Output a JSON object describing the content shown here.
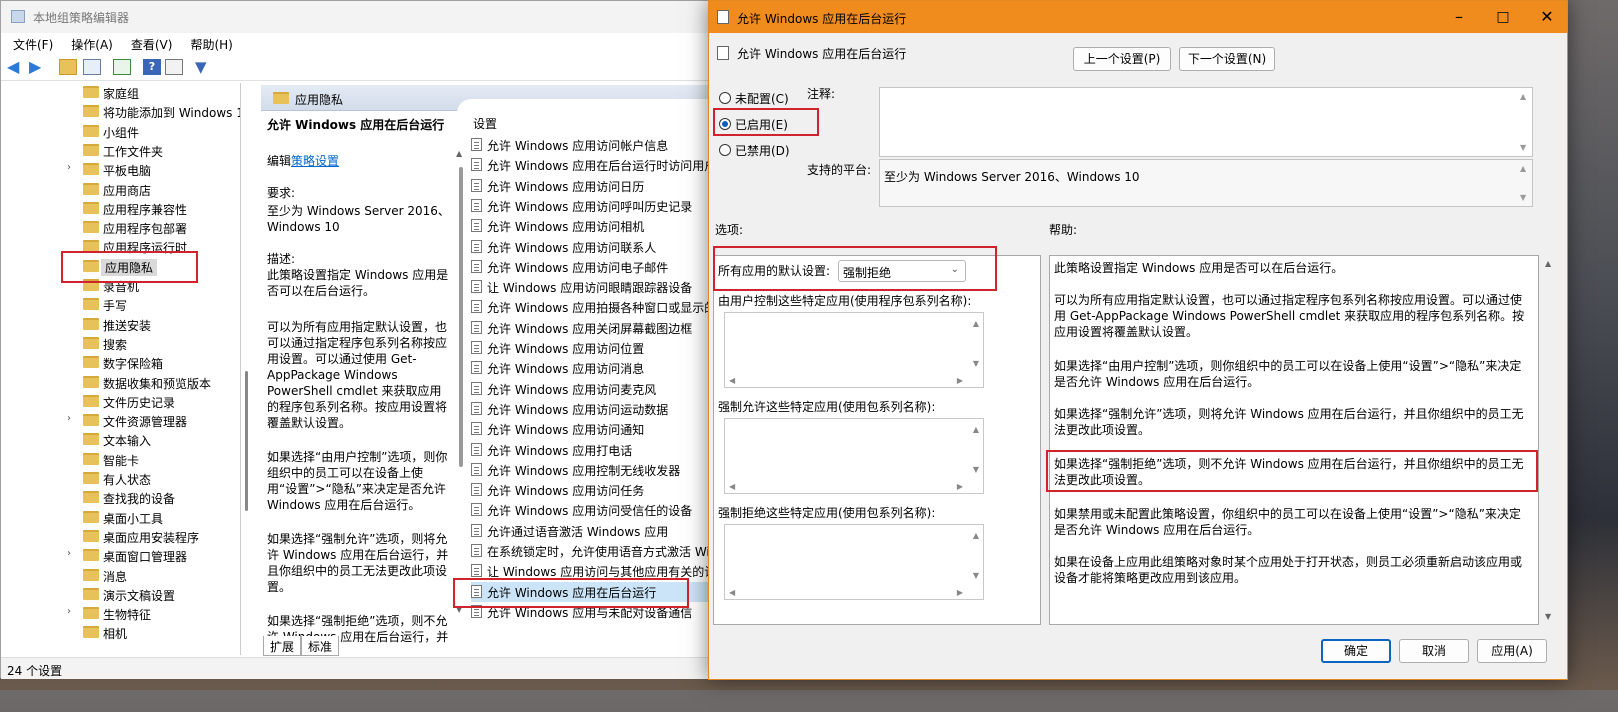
{
  "editor": {
    "title": "本地组策略编辑器",
    "menu": [
      "文件(F)",
      "操作(A)",
      "查看(V)",
      "帮助(H)"
    ],
    "tree": [
      {
        "label": "家庭组",
        "chev": false
      },
      {
        "label": "将功能添加到 Windows 1",
        "chev": false
      },
      {
        "label": "小组件",
        "chev": false
      },
      {
        "label": "工作文件夹",
        "chev": false
      },
      {
        "label": "平板电脑",
        "chev": true
      },
      {
        "label": "应用商店",
        "chev": false
      },
      {
        "label": "应用程序兼容性",
        "chev": false
      },
      {
        "label": "应用程序包部署",
        "chev": false
      },
      {
        "label": "应用程序运行时",
        "chev": false
      },
      {
        "label": "应用隐私",
        "chev": false
      },
      {
        "label": "录音机",
        "chev": false
      },
      {
        "label": "手写",
        "chev": false
      },
      {
        "label": "推送安装",
        "chev": false
      },
      {
        "label": "搜索",
        "chev": false
      },
      {
        "label": "数字保险箱",
        "chev": false
      },
      {
        "label": "数据收集和预览版本",
        "chev": false
      },
      {
        "label": "文件历史记录",
        "chev": false
      },
      {
        "label": "文件资源管理器",
        "chev": true
      },
      {
        "label": "文本输入",
        "chev": false
      },
      {
        "label": "智能卡",
        "chev": false
      },
      {
        "label": "有人状态",
        "chev": false
      },
      {
        "label": "查找我的设备",
        "chev": false
      },
      {
        "label": "桌面小工具",
        "chev": false
      },
      {
        "label": "桌面应用安装程序",
        "chev": false
      },
      {
        "label": "桌面窗口管理器",
        "chev": true
      },
      {
        "label": "消息",
        "chev": false
      },
      {
        "label": "演示文稿设置",
        "chev": false
      },
      {
        "label": "生物特征",
        "chev": true
      },
      {
        "label": "相机",
        "chev": false
      }
    ],
    "folder_header": "应用隐私",
    "desc": {
      "title": "允许 Windows 应用在后台运行",
      "edit_prefix": "编辑",
      "edit_link": "策略设置",
      "req_label": "要求:",
      "req_text": "至少为 Windows Server 2016、Windows 10",
      "desc_label": "描述:",
      "desc_text": "此策略设置指定 Windows 应用是否可以在后台运行。",
      "p1": "可以为所有应用指定默认设置，也可以通过指定程序包系列名称按应用设置。可以通过使用 Get-AppPackage Windows PowerShell cmdlet 来获取应用的程序包系列名称。按应用设置将覆盖默认设置。",
      "p2": "如果选择“由用户控制”选项，则你组织中的员工可以在设备上使用“设置”>“隐私”来决定是否允许 Windows 应用在后台运行。",
      "p3": "如果选择“强制允许”选项，则将允许 Windows 应用在后台运行，并且你组织中的员工无法更改此项设置。",
      "p4": "如果选择“强制拒绝”选项，则不允许 Windows 应用在后台运行，并"
    },
    "list_header": "设置",
    "settings": [
      "允许 Windows 应用访问帐户信息",
      "允许 Windows 应用在后台运行时访问用户",
      "允许 Windows 应用访问日历",
      "允许 Windows 应用访问呼叫历史记录",
      "允许 Windows 应用访问相机",
      "允许 Windows 应用访问联系人",
      "允许 Windows 应用访问电子邮件",
      "让 Windows 应用访问眼睛跟踪器设备",
      "允许 Windows 应用拍摄各种窗口或显示的",
      "允许 Windows 应用关闭屏幕截图边框",
      "允许 Windows 应用访问位置",
      "允许 Windows 应用访问消息",
      "允许 Windows 应用访问麦克风",
      "允许 Windows 应用访问运动数据",
      "允许 Windows 应用访问通知",
      "允许 Windows 应用打电话",
      "允许 Windows 应用控制无线收发器",
      "允许 Windows 应用访问任务",
      "允许 Windows 应用访问受信任的设备",
      "允许通过语音激活 Windows 应用",
      "在系统锁定时，允许使用语音方式激活 Wi",
      "让 Windows 应用访问与其他应用有关的诊",
      "允许 Windows 应用在后台运行",
      "允许 Windows 应用与未配对设备通信"
    ],
    "selected_setting": 22,
    "tabs": [
      "扩展",
      "标准"
    ],
    "status": "24 个设置"
  },
  "dialog": {
    "title": "允许 Windows 应用在后台运行",
    "policy_name": "允许 Windows 应用在后台运行",
    "prev_button": "上一个设置(P)",
    "next_button": "下一个设置(N)",
    "radios": [
      {
        "label": "未配置(C)",
        "checked": false
      },
      {
        "label": "已启用(E)",
        "checked": true
      },
      {
        "label": "已禁用(D)",
        "checked": false
      }
    ],
    "comment_label": "注释:",
    "platform_label": "支持的平台:",
    "platform_value": "至少为 Windows Server 2016、Windows 10",
    "options_label": "选项:",
    "help_label": "帮助:",
    "default_label": "所有应用的默认设置:",
    "default_value": "强制拒绝",
    "list1_label": "由用户控制这些特定应用(使用程序包系列名称):",
    "list2_label": "强制允许这些特定应用(使用包系列名称):",
    "list3_label": "强制拒绝这些特定应用(使用包系列名称):",
    "help": {
      "p1": "此策略设置指定 Windows 应用是否可以在后台运行。",
      "p2": "可以为所有应用指定默认设置，也可以通过指定程序包系列名称按应用设置。可以通过使用 Get-AppPackage Windows PowerShell cmdlet 来获取应用的程序包系列名称。按应用设置将覆盖默认设置。",
      "p3": "如果选择“由用户控制”选项，则你组织中的员工可以在设备上使用“设置”>“隐私”来决定是否允许 Windows 应用在后台运行。",
      "p4": "如果选择“强制允许”选项，则将允许 Windows 应用在后台运行，并且你组织中的员工无法更改此项设置。",
      "p5": "如果选择“强制拒绝”选项，则不允许 Windows 应用在后台运行，并且你组织中的员工无法更改此项设置。",
      "p6": "如果禁用或未配置此策略设置，你组织中的员工可以在设备上使用“设置”>“隐私”来决定是否允许 Windows 应用在后台运行。",
      "p7": "如果在设备上应用此组策略对象时某个应用处于打开状态，则员工必须重新启动该应用或设备才能将策略更改应用到该应用。"
    },
    "ok_button": "确定",
    "cancel_button": "取消",
    "apply_button": "应用(A)"
  },
  "colors": {
    "dialog_titlebar": "#f08c1e",
    "highlight_box": "#d0232b",
    "selection": "#cce4f7"
  }
}
